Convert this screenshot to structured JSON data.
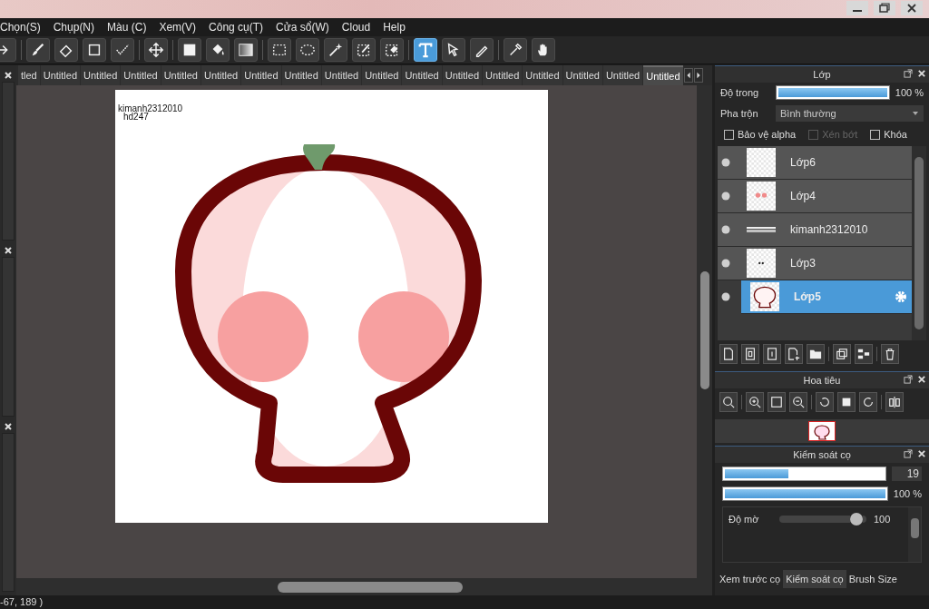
{
  "menu": [
    "Chọn(S)",
    "Chụp(N)",
    "Màu (C)",
    "Xem(V)",
    "Công cụ(T)",
    "Cửa sổ(W)",
    "Cloud",
    "Help"
  ],
  "toolbar": [
    [
      {
        "kind": "arrow",
        "selected": false
      }
    ],
    [
      {
        "kind": "brush",
        "selected": false
      },
      {
        "kind": "eraser",
        "selected": false
      },
      {
        "kind": "square",
        "selected": false
      },
      {
        "kind": "dots",
        "selected": false
      }
    ],
    [
      {
        "kind": "move",
        "selected": false
      }
    ],
    [
      {
        "kind": "fill",
        "selected": false
      },
      {
        "kind": "bucket",
        "selected": false
      },
      {
        "kind": "gradient",
        "selected": false
      }
    ],
    [
      {
        "kind": "select",
        "selected": false
      },
      {
        "kind": "lasso",
        "selected": false
      },
      {
        "kind": "wand",
        "selected": false
      },
      {
        "kind": "selpen",
        "selected": false
      },
      {
        "kind": "selerase",
        "selected": false
      }
    ],
    [
      {
        "kind": "text",
        "selected": true
      },
      {
        "kind": "pointer",
        "selected": false
      },
      {
        "kind": "pen",
        "selected": false
      }
    ],
    [
      {
        "kind": "dropper",
        "selected": false
      },
      {
        "kind": "hand",
        "selected": false
      }
    ]
  ],
  "document_tabs": [
    {
      "label": "tled",
      "selected": false
    },
    {
      "label": "Untitled",
      "selected": false
    },
    {
      "label": "Untitled",
      "selected": false
    },
    {
      "label": "Untitled",
      "selected": false
    },
    {
      "label": "Untitled",
      "selected": false
    },
    {
      "label": "Untitled",
      "selected": false
    },
    {
      "label": "Untitled",
      "selected": false
    },
    {
      "label": "Untitled",
      "selected": false
    },
    {
      "label": "Untitled",
      "selected": false
    },
    {
      "label": "Untitled",
      "selected": false
    },
    {
      "label": "Untitled",
      "selected": false
    },
    {
      "label": "Untitled",
      "selected": false
    },
    {
      "label": "Untitled",
      "selected": false
    },
    {
      "label": "Untitled",
      "selected": false
    },
    {
      "label": "Untitled",
      "selected": false
    },
    {
      "label": "Untitled",
      "selected": false
    },
    {
      "label": "Untitled",
      "selected": true
    }
  ],
  "canvas": {
    "texts": [
      "kimanh2312010",
      "hd247"
    ]
  },
  "layers_panel": {
    "title": "Lớp",
    "opacity": {
      "label": "Độ trong",
      "level": 1,
      "reading": "100 %"
    },
    "blend": {
      "label": "Pha trộn",
      "value": "Bình thường"
    },
    "options": [
      {
        "label": "Bảo vệ alpha",
        "checked": false,
        "disabled": false
      },
      {
        "label": "Xén bớt",
        "checked": false,
        "disabled": true
      },
      {
        "label": "Khóa",
        "checked": false,
        "disabled": false
      }
    ],
    "layers": [
      {
        "name": "Lớp6",
        "selected": false,
        "kind": "blank"
      },
      {
        "name": "Lớp4",
        "selected": false,
        "kind": "dots"
      },
      {
        "name": "kimanh2312010",
        "selected": false,
        "kind": "text"
      },
      {
        "name": "Lớp3",
        "selected": false,
        "kind": "eyes"
      },
      {
        "name": "Lớp5",
        "selected": true,
        "kind": "outline"
      }
    ]
  },
  "navigator": {
    "title": "Hoa tiêu"
  },
  "brush_panel": {
    "title": "Kiểm soát cọ",
    "size": {
      "level": 0.4,
      "value": "19"
    },
    "opacity": {
      "level": 1,
      "reading": "100 %"
    },
    "params": [
      {
        "label": "Độ mờ",
        "level": 0.95,
        "reading": "100"
      }
    ],
    "tabs": [
      {
        "label": "Xem trước cọ",
        "selected": false
      },
      {
        "label": "Kiểm soát cọ",
        "selected": true
      },
      {
        "label": "Brush Size",
        "selected": false
      }
    ]
  },
  "status_bar": "-67, 189 )"
}
